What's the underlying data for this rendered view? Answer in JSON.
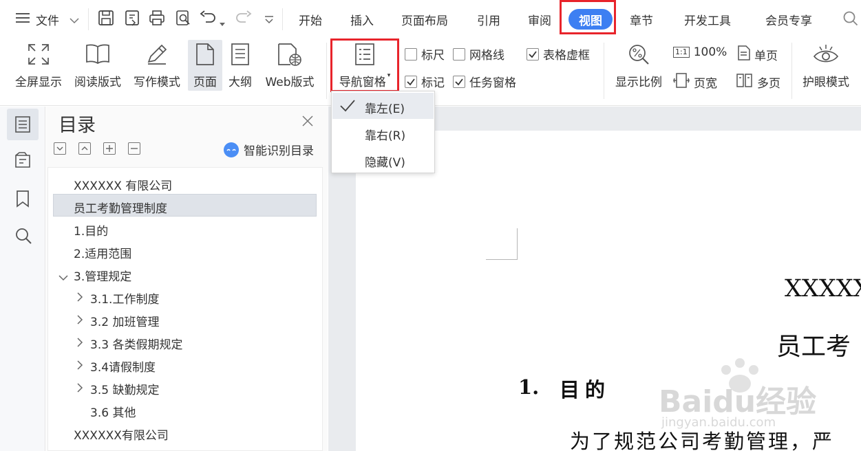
{
  "toolbar": {
    "menu_icon": "hamburger-icon",
    "file_label": "文件",
    "tabs": [
      "开始",
      "插入",
      "页面布局",
      "引用",
      "审阅",
      "视图",
      "章节",
      "开发工具",
      "会员专享"
    ],
    "active_tab": "视图"
  },
  "ribbon": {
    "fullscreen": "全屏显示",
    "reading": "阅读版式",
    "writing": "写作模式",
    "page": "页面",
    "outline": "大纲",
    "web": "Web版式",
    "nav_pane": "导航窗格",
    "ruler": "标尺",
    "gridlines": "网格线",
    "table_gridlines": "表格虚框",
    "marks": "标记",
    "task_pane": "任务窗格",
    "zoom": "显示比例",
    "zoom_100": "100%",
    "one_page": "单页",
    "page_width": "页宽",
    "multi_page": "多页",
    "eye_mode": "护眼模式",
    "checks": {
      "ruler": false,
      "gridlines": false,
      "table_gridlines": true,
      "marks": true,
      "task_pane": true
    }
  },
  "dropdown": {
    "items": [
      "靠左(E)",
      "靠右(R)",
      "隐藏(V)"
    ],
    "checked_index": 0
  },
  "nav": {
    "title": "目录",
    "smart": "智能识别目录",
    "items": [
      "XXXXXX 有限公司",
      "员工考勤管理制度",
      "1.目的",
      "2.适用范围",
      "3.管理规定",
      "3.1.工作制度",
      "3.2 加班管理",
      "3.3 各类假期规定",
      "3.4请假制度",
      "3.5 缺勤规定",
      "3.6 其他",
      "XXXXXX有限公司"
    ],
    "selected_index": 1
  },
  "doc": {
    "company": "XXXXXX",
    "title_partial": "员工考",
    "heading_num": "1.",
    "heading": "目的",
    "body_partial": "为了规范公司考勤管理，严"
  },
  "watermark": {
    "brand": "Baidu经验",
    "url": "jingyan.baidu.com"
  },
  "colors": {
    "accent": "#3d7ff2",
    "highlight": "#e8242b",
    "selected_bg": "#dfe3e9"
  }
}
